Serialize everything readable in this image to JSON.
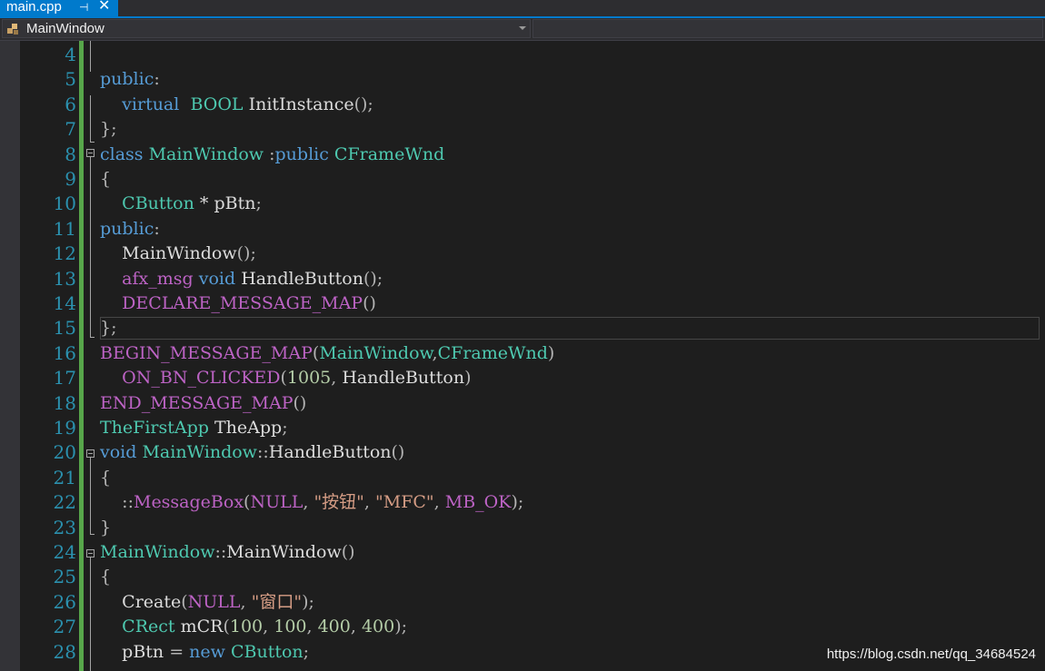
{
  "tab": {
    "label": "main.cpp",
    "pin": "⊣",
    "close": "✕"
  },
  "navbar": {
    "scope": "MainWindow"
  },
  "line_numbers": [
    "4",
    "5",
    "6",
    "7",
    "8",
    "9",
    "10",
    "11",
    "12",
    "13",
    "14",
    "15",
    "16",
    "17",
    "18",
    "19",
    "20",
    "21",
    "22",
    "23",
    "24",
    "25",
    "26",
    "27",
    "28"
  ],
  "code": [
    [],
    [
      [
        "kw",
        "public"
      ],
      [
        "pu",
        ":"
      ]
    ],
    [
      [
        "pl",
        "    "
      ],
      [
        "kw",
        "virtual"
      ],
      [
        "pl",
        "  "
      ],
      [
        "ty",
        "BOOL"
      ],
      [
        "pl",
        " InitInstance"
      ],
      [
        "pu",
        "();"
      ]
    ],
    [
      [
        "pu",
        "};"
      ]
    ],
    [
      [
        "kw",
        "class"
      ],
      [
        "pl",
        " "
      ],
      [
        "ty",
        "MainWindow"
      ],
      [
        "pl",
        " "
      ],
      [
        "pu",
        ":"
      ],
      [
        "kw",
        "public"
      ],
      [
        "pl",
        " "
      ],
      [
        "ty",
        "CFrameWnd"
      ]
    ],
    [
      [
        "pu",
        "{"
      ]
    ],
    [
      [
        "pl",
        "    "
      ],
      [
        "ty",
        "CButton"
      ],
      [
        "pl",
        " * pBtn"
      ],
      [
        "pu",
        ";"
      ]
    ],
    [
      [
        "kw",
        "public"
      ],
      [
        "pu",
        ":"
      ]
    ],
    [
      [
        "pl",
        "    MainWindow"
      ],
      [
        "pu",
        "();"
      ]
    ],
    [
      [
        "pl",
        "    "
      ],
      [
        "mac",
        "afx_msg"
      ],
      [
        "pl",
        " "
      ],
      [
        "kw",
        "void"
      ],
      [
        "pl",
        " HandleButton"
      ],
      [
        "pu",
        "();"
      ]
    ],
    [
      [
        "pl",
        "    "
      ],
      [
        "mac",
        "DECLARE_MESSAGE_MAP"
      ],
      [
        "pu",
        "()"
      ]
    ],
    [
      [
        "pu",
        "};"
      ]
    ],
    [
      [
        "mac",
        "BEGIN_MESSAGE_MAP"
      ],
      [
        "pu",
        "("
      ],
      [
        "ty",
        "MainWindow"
      ],
      [
        "pu",
        ","
      ],
      [
        "ty",
        "CFrameWnd"
      ],
      [
        "pu",
        ")"
      ]
    ],
    [
      [
        "pl",
        "    "
      ],
      [
        "mac",
        "ON_BN_CLICKED"
      ],
      [
        "pu",
        "("
      ],
      [
        "num",
        "1005"
      ],
      [
        "pu",
        ","
      ],
      [
        "pl",
        " HandleButton"
      ],
      [
        "pu",
        ")"
      ]
    ],
    [
      [
        "mac",
        "END_MESSAGE_MAP"
      ],
      [
        "pu",
        "()"
      ]
    ],
    [
      [
        "ty",
        "TheFirstApp"
      ],
      [
        "pl",
        " TheApp"
      ],
      [
        "pu",
        ";"
      ]
    ],
    [
      [
        "kw",
        "void"
      ],
      [
        "pl",
        " "
      ],
      [
        "ty",
        "MainWindow"
      ],
      [
        "pu",
        "::"
      ],
      [
        "pl",
        "HandleButton"
      ],
      [
        "pu",
        "()"
      ]
    ],
    [
      [
        "pu",
        "{"
      ]
    ],
    [
      [
        "pl",
        "    "
      ],
      [
        "pu",
        "::"
      ],
      [
        "mac",
        "MessageBox"
      ],
      [
        "pu",
        "("
      ],
      [
        "mac",
        "NULL"
      ],
      [
        "pu",
        ","
      ],
      [
        "pl",
        " "
      ],
      [
        "str",
        "\"按钮\""
      ],
      [
        "pu",
        ","
      ],
      [
        "pl",
        " "
      ],
      [
        "str",
        "\"MFC\""
      ],
      [
        "pu",
        ","
      ],
      [
        "pl",
        " "
      ],
      [
        "mac",
        "MB_OK"
      ],
      [
        "pu",
        ");"
      ]
    ],
    [
      [
        "pu",
        "}"
      ]
    ],
    [
      [
        "ty",
        "MainWindow"
      ],
      [
        "pu",
        "::"
      ],
      [
        "pl",
        "MainWindow"
      ],
      [
        "pu",
        "()"
      ]
    ],
    [
      [
        "pu",
        "{"
      ]
    ],
    [
      [
        "pl",
        "    Create"
      ],
      [
        "pu",
        "("
      ],
      [
        "mac",
        "NULL"
      ],
      [
        "pu",
        ","
      ],
      [
        "pl",
        " "
      ],
      [
        "str",
        "\"窗口\""
      ],
      [
        "pu",
        ");"
      ]
    ],
    [
      [
        "pl",
        "    "
      ],
      [
        "ty",
        "CRect"
      ],
      [
        "pl",
        " mCR"
      ],
      [
        "pu",
        "("
      ],
      [
        "num",
        "100"
      ],
      [
        "pu",
        ","
      ],
      [
        "pl",
        " "
      ],
      [
        "num",
        "100"
      ],
      [
        "pu",
        ","
      ],
      [
        "pl",
        " "
      ],
      [
        "num",
        "400"
      ],
      [
        "pu",
        ","
      ],
      [
        "pl",
        " "
      ],
      [
        "num",
        "400"
      ],
      [
        "pu",
        ");"
      ]
    ],
    [
      [
        "pl",
        "    pBtn "
      ],
      [
        "pu",
        "="
      ],
      [
        "pl",
        " "
      ],
      [
        "kw",
        "new"
      ],
      [
        "pl",
        " "
      ],
      [
        "ty",
        "CButton"
      ],
      [
        "pu",
        ";"
      ]
    ]
  ],
  "watermark": "https://blog.csdn.net/qq_34684524",
  "colors": {
    "accent": "#007acc",
    "keyword": "#569cd6",
    "type": "#4ec9b0",
    "macro": "#bd63c5",
    "string": "#d69d85",
    "number": "#b5cea8",
    "line_number": "#2b91af",
    "change_bar": "#57a64a"
  }
}
